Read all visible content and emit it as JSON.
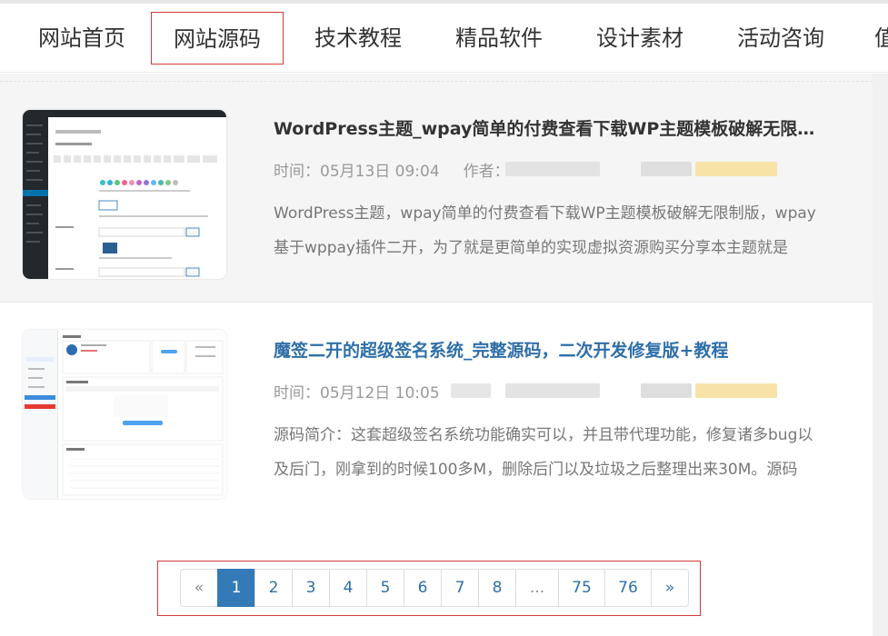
{
  "nav": {
    "items": [
      "网站首页",
      "网站源码",
      "技术教程",
      "精品软件",
      "设计素材",
      "活动咨询",
      "值"
    ],
    "active_index": 1
  },
  "posts": [
    {
      "title": "WordPress主题_wpay简单的付费查看下载WP主题模板破解无限制版",
      "time": "时间：05月13日 09:04",
      "author_label": "作者：",
      "description": "WordPress主题，wpay简单的付费查看下载WP主题模板破解无限制版，wpay基于wppay插件二开，为了就是更简单的实现虚拟资源购买分享本主题就是"
    },
    {
      "title": "魔签二开的超级签名系统_完整源码，二次开发修复版+教程",
      "time": "时间：05月12日 10:05",
      "description": "源码简介：这套超级签名系统功能确实可以，并且带代理功能，修复诸多bug以及后门，刚拿到的时候100多M，删除后门以及垃圾之后整理出来30M。源码"
    }
  ],
  "pagination": {
    "prev": "«",
    "pages": [
      "1",
      "2",
      "3",
      "4",
      "5",
      "6",
      "7",
      "8",
      "...",
      "75",
      "76"
    ],
    "next": "»",
    "current": "1"
  },
  "colors": {
    "accent": "#337ab7",
    "link_title": "#2f6fa8",
    "highlight_border": "#d33a3a"
  }
}
